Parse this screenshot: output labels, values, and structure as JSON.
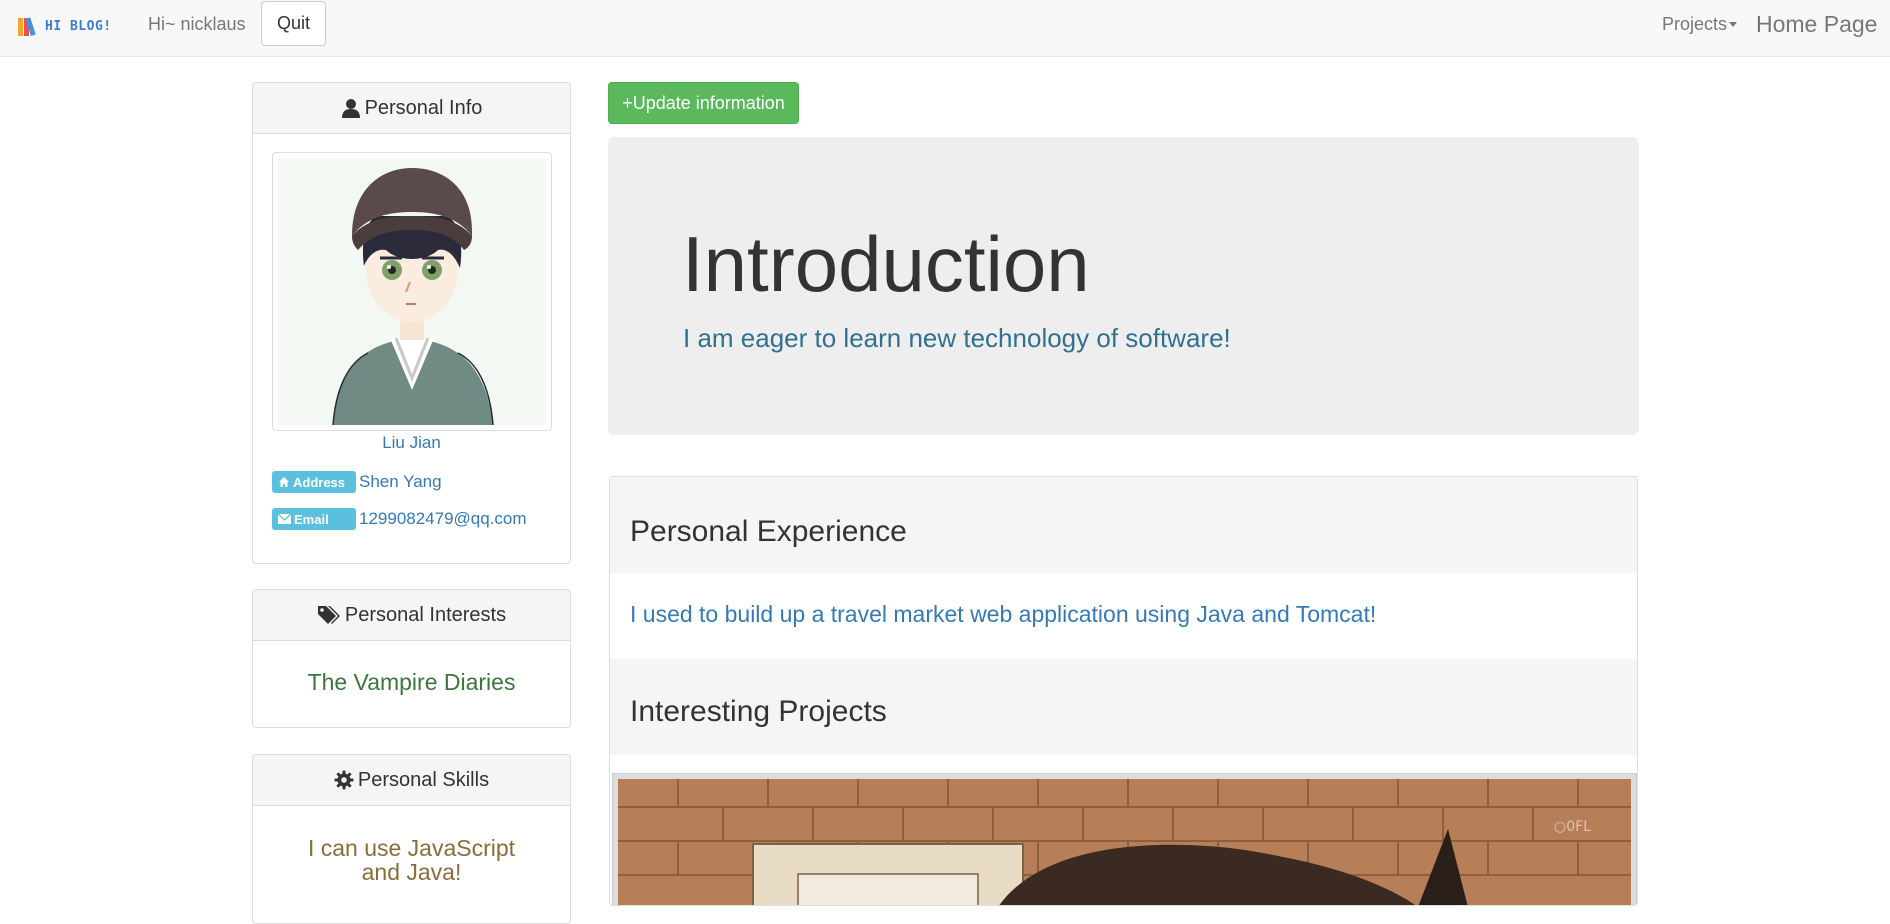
{
  "navbar": {
    "logo_text": "HI BLOG!",
    "greeting": "Hi~ nicklaus",
    "quit_label": "Quit",
    "projects_label": "Projects",
    "home_label": "Home Page"
  },
  "sidebar": {
    "personal_info": {
      "heading": "Personal Info",
      "name": "Liu Jian",
      "address_badge": "Address",
      "address": "Shen Yang",
      "email_badge": "Email",
      "email": "1299082479@qq.com"
    },
    "interests": {
      "heading": "Personal Interests",
      "text": "The Vampire Diaries"
    },
    "skills": {
      "heading": "Personal Skills",
      "text": "I can use JavaScript and Java!"
    }
  },
  "main": {
    "update_button": "+Update information",
    "jumbotron": {
      "title": "Introduction",
      "subtitle": "I am eager to learn new technology of software!"
    },
    "experience": {
      "heading": "Personal Experience",
      "text": "I used to build up a travel market web application using Java and Tomcat!"
    },
    "projects": {
      "heading": "Interesting Projects",
      "image_watermark": "○0FL"
    }
  },
  "colors": {
    "navbar_bg": "#f8f8f8",
    "link_blue": "#337ab7",
    "success_green": "#5cb85c",
    "info_badge": "#5bc0de",
    "interest_green": "#3c763d",
    "skill_brown": "#8a6d3b",
    "jumbotron_bg": "#eeeeee"
  },
  "icons": {
    "info": "user-icon",
    "interests": "tags-icon",
    "skills": "gear-icon",
    "address": "home-icon",
    "email": "envelope-icon"
  }
}
